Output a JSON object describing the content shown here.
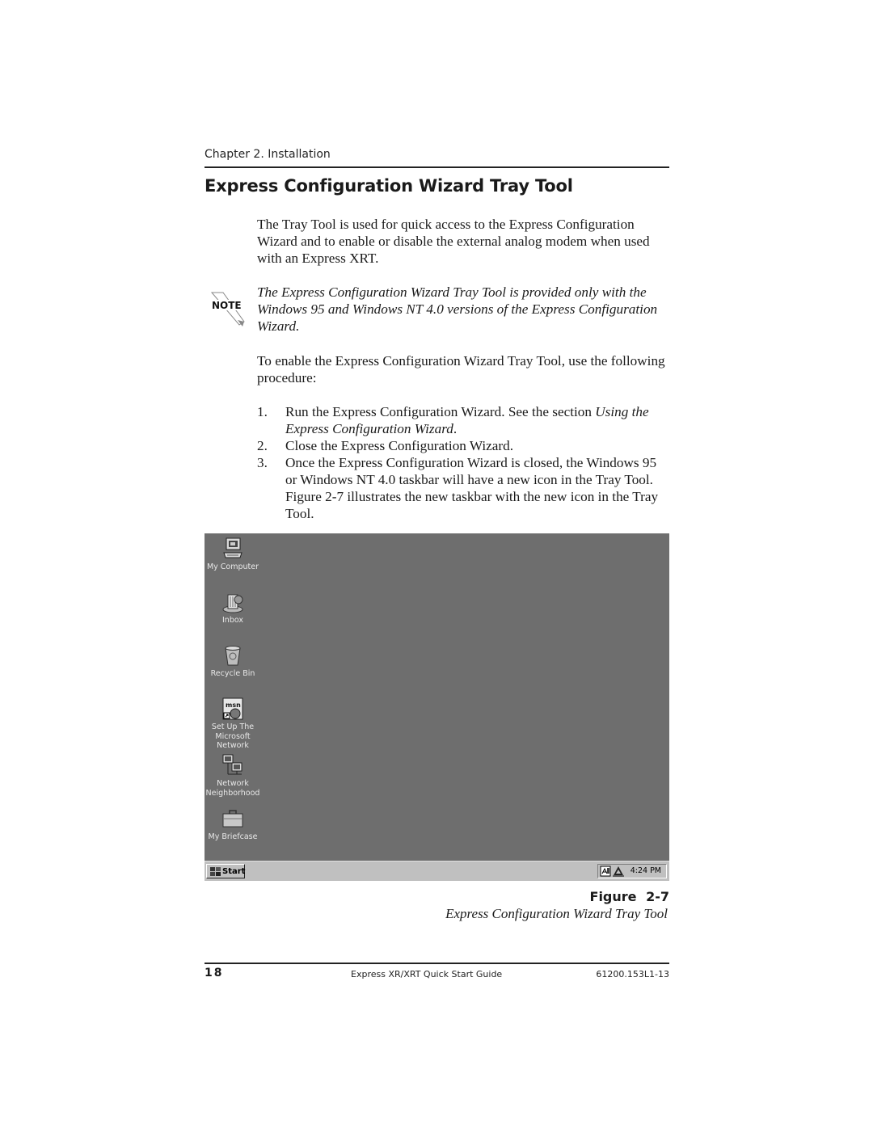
{
  "header": {
    "chapter": "Chapter 2.  Installation",
    "section_title": "Express Configuration Wizard Tray Tool"
  },
  "body": {
    "para1": "The Tray Tool is used for quick access to the Express Configuration Wizard and to enable or disable the external analog modem when used with an Express XRT.",
    "note_label": "NOTE",
    "note": "The Express Configuration Wizard Tray Tool is provided only with the Windows 95 and Windows NT 4.0 versions of the Express Configuration Wizard.",
    "para2": "To enable the Express Configuration Wizard Tray Tool, use the following procedure:",
    "steps": [
      {
        "num": "1.",
        "text": "Run the Express Configuration Wizard.  See the section ",
        "italic": "Using the Express Configuration Wizard",
        "suffix": "."
      },
      {
        "num": "2.",
        "text": "Close the Express Configuration Wizard.",
        "italic": "",
        "suffix": ""
      },
      {
        "num": "3.",
        "text": "Once the Express Configuration Wizard is closed, the Windows 95 or Windows NT 4.0 taskbar will have a new icon in the Tray Tool.  Figure 2-7 illustrates the new taskbar with the new icon in the Tray Tool.",
        "italic": "",
        "suffix": ""
      }
    ]
  },
  "screenshot": {
    "desktop_icons": [
      {
        "label": "My Computer",
        "icon": "computer-icon"
      },
      {
        "label": "Inbox",
        "icon": "inbox-icon"
      },
      {
        "label": "Recycle Bin",
        "icon": "recycle-bin-icon"
      },
      {
        "label": "Set Up The Microsoft Network",
        "icon": "msn-icon"
      },
      {
        "label": "Network Neighborhood",
        "icon": "network-icon"
      },
      {
        "label": "My Briefcase",
        "icon": "briefcase-icon"
      }
    ],
    "taskbar": {
      "start_label": "Start",
      "clock": "4:24 PM",
      "tray_icons": [
        "wizard-tray-icon",
        "modem-tray-icon"
      ]
    },
    "colors": {
      "desktop": "#6e6e6e",
      "taskbar": "#c0c0c0"
    }
  },
  "figure": {
    "label": "Figure 2-7",
    "caption": "Express Configuration Wizard Tray Tool"
  },
  "footer": {
    "page_number": "18",
    "title": "Express XR/XRT Quick Start Guide",
    "doc_number": "61200.153L1-13"
  }
}
